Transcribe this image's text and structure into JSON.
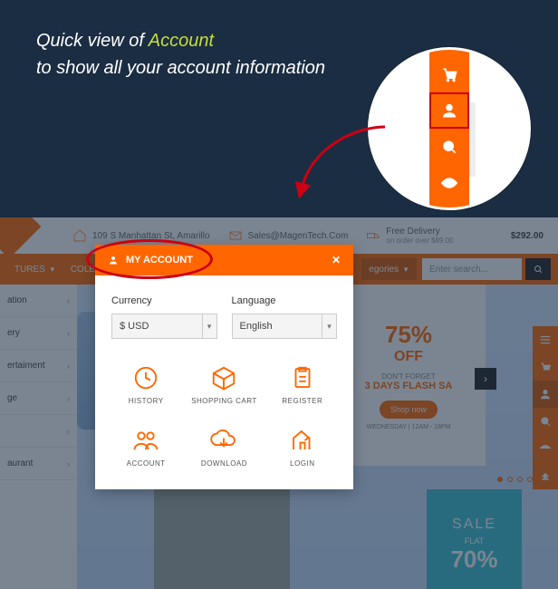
{
  "title": {
    "pre": "Quick view of ",
    "hi": "Account",
    "post": "to show all your  account information"
  },
  "topbar": {
    "addr": "109 S Manhattan St, Amarillo",
    "email": "Sales@MagenTech.Com",
    "shipping_label": "Free Delivery",
    "shipping_note": "on order over $89.00",
    "price": "$292.00"
  },
  "nav": {
    "tures": "TURES",
    "collections": "COLECTIONS",
    "categories": "egories",
    "search_placeholder": "Enter search..."
  },
  "sidebar_items": [
    "ation",
    "ery",
    "ertaiment",
    "ge",
    "",
    "aurant"
  ],
  "promo": {
    "pct": "75%",
    "off": "OFF",
    "small": "DON'T FORGET",
    "days": "3 DAYS FLASH SA",
    "shop": "Shop now",
    "time": "WEDNESDAY | 12AM - 18PM"
  },
  "sale_banner": {
    "s": "SALE",
    "f": "FLAT",
    "p": "70%"
  },
  "modal": {
    "title": "MY ACCOUNT",
    "currency_label": "Currency",
    "currency_val": "$ USD",
    "language_label": "Language",
    "language_val": "English",
    "tiles": [
      {
        "id": "history",
        "label": "HISTORY"
      },
      {
        "id": "cart",
        "label": "SHOPPING CART"
      },
      {
        "id": "register",
        "label": "REGISTER"
      },
      {
        "id": "account",
        "label": "ACCOUNT"
      },
      {
        "id": "download",
        "label": "DOWNLOAD"
      },
      {
        "id": "login",
        "label": "LOGIN"
      }
    ]
  }
}
